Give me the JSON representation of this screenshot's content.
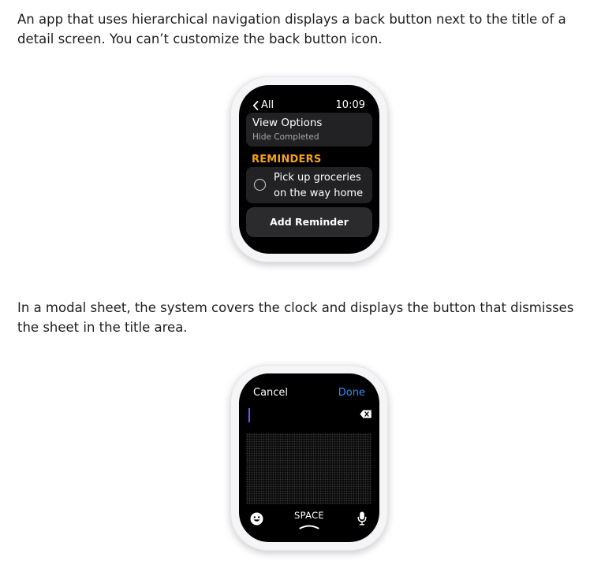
{
  "paragraphs": {
    "p1": "An app that uses hierarchical navigation displays a back button next to the title of a detail screen. You can’t customize the back button icon.",
    "p2": "In a modal sheet, the system covers the clock and displays the button that dismisses the sheet in the title area."
  },
  "watch1": {
    "back_label": "All",
    "back_icon": "chevron-left-icon",
    "time": "10:09",
    "view_options": {
      "title": "View Options",
      "subtitle": "Hide Completed"
    },
    "section_header": "REMINDERS",
    "reminder": {
      "text": "Pick up groceries on the way home",
      "icon": "circle-checkbox-icon"
    },
    "add_button": "Add Reminder"
  },
  "watch2": {
    "cancel": "Cancel",
    "done": "Done",
    "space_label": "SPACE",
    "icons": [
      "delete-icon",
      "emoji-icon",
      "microphone-icon",
      "space-caret-icon"
    ]
  },
  "colors": {
    "accent_orange": "#f7a11c",
    "done_blue": "#2d8dfd",
    "cursor": "#5a5dff"
  }
}
